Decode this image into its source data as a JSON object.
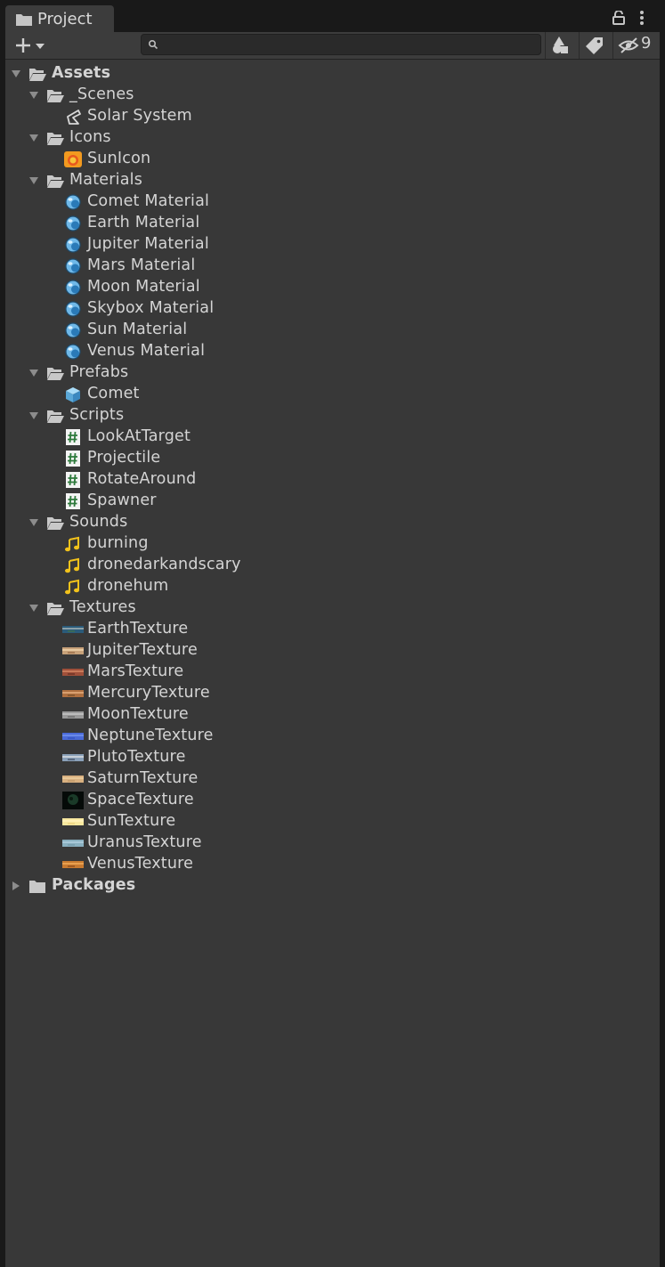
{
  "tab": {
    "title": "Project"
  },
  "toolbar": {
    "hidden_count": "9",
    "search_value": ""
  },
  "tree": [
    {
      "label": "Assets",
      "depth": 0,
      "kind": "folder-open",
      "expanded": true,
      "bold": true
    },
    {
      "label": "_Scenes",
      "depth": 1,
      "kind": "folder-open",
      "expanded": true
    },
    {
      "label": "Solar System",
      "depth": 2,
      "kind": "scene"
    },
    {
      "label": "Icons",
      "depth": 1,
      "kind": "folder-open",
      "expanded": true
    },
    {
      "label": "SunIcon",
      "depth": 2,
      "kind": "sunicon"
    },
    {
      "label": "Materials",
      "depth": 1,
      "kind": "folder-open",
      "expanded": true
    },
    {
      "label": "Comet Material",
      "depth": 2,
      "kind": "material"
    },
    {
      "label": "Earth Material",
      "depth": 2,
      "kind": "material"
    },
    {
      "label": "Jupiter Material",
      "depth": 2,
      "kind": "material"
    },
    {
      "label": "Mars Material",
      "depth": 2,
      "kind": "material"
    },
    {
      "label": "Moon Material",
      "depth": 2,
      "kind": "material"
    },
    {
      "label": "Skybox Material",
      "depth": 2,
      "kind": "material"
    },
    {
      "label": "Sun Material",
      "depth": 2,
      "kind": "material"
    },
    {
      "label": "Venus Material",
      "depth": 2,
      "kind": "material"
    },
    {
      "label": "Prefabs",
      "depth": 1,
      "kind": "folder-open",
      "expanded": true
    },
    {
      "label": "Comet",
      "depth": 2,
      "kind": "prefab"
    },
    {
      "label": "Scripts",
      "depth": 1,
      "kind": "folder-open",
      "expanded": true
    },
    {
      "label": "LookAtTarget",
      "depth": 2,
      "kind": "script"
    },
    {
      "label": "Projectile",
      "depth": 2,
      "kind": "script"
    },
    {
      "label": "RotateAround",
      "depth": 2,
      "kind": "script"
    },
    {
      "label": "Spawner",
      "depth": 2,
      "kind": "script"
    },
    {
      "label": "Sounds",
      "depth": 1,
      "kind": "folder-open",
      "expanded": true
    },
    {
      "label": "burning",
      "depth": 2,
      "kind": "audio"
    },
    {
      "label": "dronedarkandscary",
      "depth": 2,
      "kind": "audio"
    },
    {
      "label": "dronehum",
      "depth": 2,
      "kind": "audio"
    },
    {
      "label": "Textures",
      "depth": 1,
      "kind": "folder-open",
      "expanded": true
    },
    {
      "label": "EarthTexture",
      "depth": 2,
      "kind": "texture",
      "colors": [
        "#2b5b7a",
        "#8aa0a8",
        "#3a6b5a"
      ]
    },
    {
      "label": "JupiterTexture",
      "depth": 2,
      "kind": "texture",
      "colors": [
        "#c8a27a",
        "#e8c9a0",
        "#a87c56"
      ]
    },
    {
      "label": "MarsTexture",
      "depth": 2,
      "kind": "texture",
      "colors": [
        "#a0503a",
        "#c87a5a",
        "#7a3a2a"
      ]
    },
    {
      "label": "MercuryTexture",
      "depth": 2,
      "kind": "texture",
      "colors": [
        "#b07040",
        "#d8a070",
        "#8a5a30"
      ]
    },
    {
      "label": "MoonTexture",
      "depth": 2,
      "kind": "texture",
      "colors": [
        "#9a9a9a",
        "#bcbcbc",
        "#7a7a7a"
      ]
    },
    {
      "label": "NeptuneTexture",
      "depth": 2,
      "kind": "texture",
      "colors": [
        "#4a6ad8",
        "#6a8ae8",
        "#3a5ac8"
      ]
    },
    {
      "label": "PlutoTexture",
      "depth": 2,
      "kind": "texture",
      "colors": [
        "#8aa0b8",
        "#c8d0d8",
        "#5a6a80"
      ]
    },
    {
      "label": "SaturnTexture",
      "depth": 2,
      "kind": "texture",
      "colors": [
        "#d8b080",
        "#e8c898",
        "#c8a070"
      ]
    },
    {
      "label": "SpaceTexture",
      "depth": 2,
      "kind": "space",
      "colors": [
        "#0a1a10",
        "#1a3a28",
        "#050a08"
      ]
    },
    {
      "label": "SunTexture",
      "depth": 2,
      "kind": "texture",
      "colors": [
        "#f8e8a0",
        "#fff0b8",
        "#f0d888"
      ]
    },
    {
      "label": "UranusTexture",
      "depth": 2,
      "kind": "texture",
      "colors": [
        "#8ab0c0",
        "#a8c8d8",
        "#7aa0b0"
      ]
    },
    {
      "label": "VenusTexture",
      "depth": 2,
      "kind": "texture",
      "colors": [
        "#c87a30",
        "#e8a050",
        "#a05a20"
      ]
    },
    {
      "label": "Packages",
      "depth": 0,
      "kind": "folder-closed",
      "expanded": false,
      "bold": true
    }
  ]
}
